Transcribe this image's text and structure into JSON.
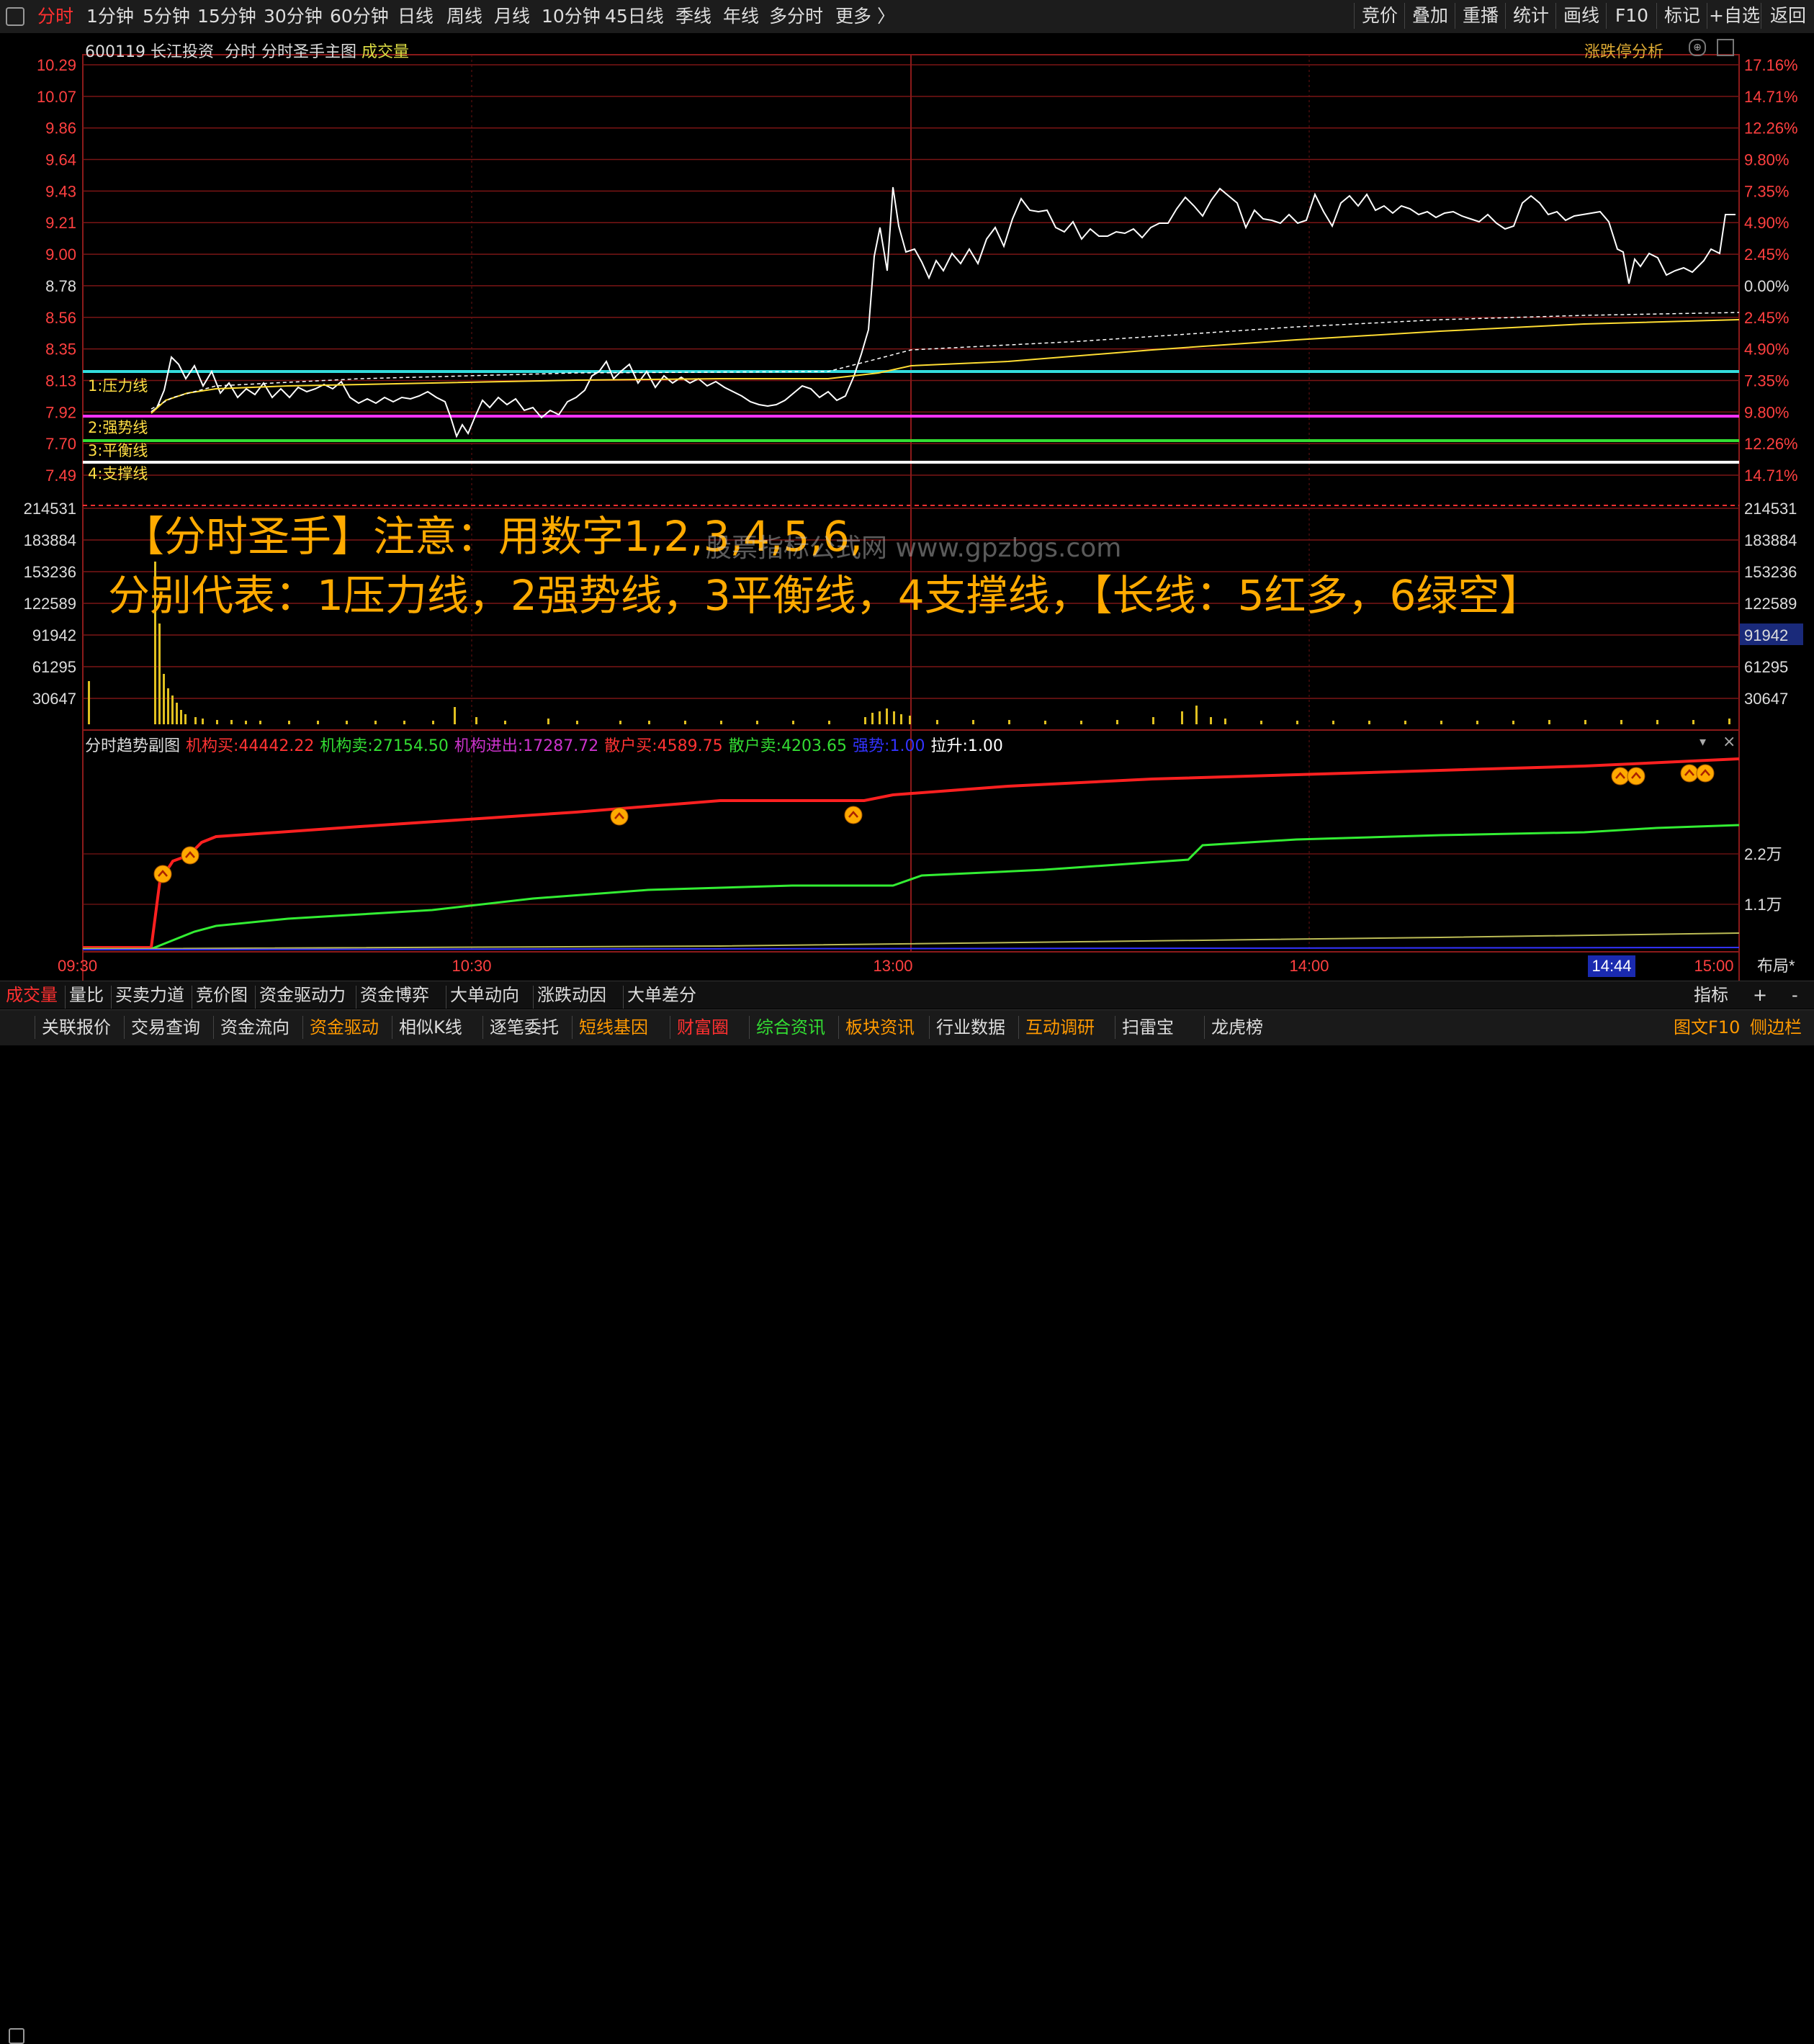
{
  "topbar": {
    "periods": [
      "分时",
      "1分钟",
      "5分钟",
      "15分钟",
      "30分钟",
      "60分钟",
      "日线",
      "周线",
      "月线",
      "10分钟",
      "45日线",
      "季线",
      "年线",
      "多分时",
      "更多 〉"
    ],
    "right_buttons": [
      "竞价",
      "叠加",
      "重播",
      "统计",
      "画线",
      "F10",
      "标记",
      "+自选",
      "返回"
    ]
  },
  "chart_header": {
    "code": "600119",
    "name": "长江投资",
    "mode": "分时",
    "indicator": "分时圣手主图",
    "volume_label": "成交量",
    "right_label": "涨跌停分析"
  },
  "price_axis": {
    "left": [
      "10.29",
      "10.07",
      "9.86",
      "9.64",
      "9.43",
      "9.21",
      "9.00",
      "8.78",
      "8.56",
      "8.35",
      "8.13",
      "7.92",
      "7.70",
      "7.49"
    ],
    "right": [
      "17.16%",
      "14.71%",
      "12.26%",
      "9.80%",
      "7.35%",
      "4.90%",
      "2.45%",
      "0.00%",
      "2.45%",
      "4.90%",
      "7.35%",
      "9.80%",
      "12.26%",
      "14.71%"
    ]
  },
  "lines": [
    {
      "label": "1:压力线",
      "color": "#33dddd"
    },
    {
      "label": "2:强势线",
      "color": "#ff33ff"
    },
    {
      "label": "3:平衡线",
      "color": "#33dd33"
    },
    {
      "label": "4:支撑线",
      "color": "#ffffff"
    }
  ],
  "volume_axis": {
    "left": [
      "214531",
      "183884",
      "153236",
      "122589",
      "91942",
      "61295",
      "30647"
    ],
    "right": [
      "214531",
      "183884",
      "153236",
      "122589",
      "91942",
      "61295",
      "30647"
    ],
    "highlight": "91942"
  },
  "annotation": {
    "line1": "【分时圣手】注意：用数字1,2,3,4,5,6,",
    "line2": "分别代表：1压力线，2强势线，3平衡线，4支撑线，【长线：5红多，6绿空】",
    "watermark": "股票指标公式网 www.gpzbgs.com"
  },
  "sub_chart": {
    "title": "分时趋势副图",
    "items": [
      {
        "label": "机构买:",
        "value": "44442.22",
        "color": "#ff3333"
      },
      {
        "label": "机构卖:",
        "value": "27154.50",
        "color": "#33dd33"
      },
      {
        "label": "机构进出:",
        "value": "17287.72",
        "color": "#cc33cc"
      },
      {
        "label": "散户买:",
        "value": "4589.75",
        "color": "#ff3333"
      },
      {
        "label": "散户卖:",
        "value": "4203.65",
        "color": "#33dd33"
      },
      {
        "label": "强势:",
        "value": "1.00",
        "color": "#3333ff"
      },
      {
        "label": "拉升:",
        "value": "1.00",
        "color": "#ffffff"
      }
    ],
    "axis": [
      "2.2万",
      "1.1万"
    ]
  },
  "time_axis": {
    "labels": [
      "09:30",
      "10:30",
      "13:00",
      "14:00",
      "15:00"
    ],
    "cursor": "14:44",
    "layout_label": "布局*"
  },
  "bottom_tabs": {
    "tabs": [
      "成交量",
      "量比",
      "买卖力道",
      "竞价图",
      "资金驱动力",
      "资金博弈",
      "大单动向",
      "涨跌动因",
      "大单差分"
    ],
    "right": [
      "指标",
      "+",
      "-"
    ]
  },
  "bottom_links": {
    "items": [
      "关联报价",
      "交易查询",
      "资金流向",
      "资金驱动",
      "相似K线",
      "逐笔委托",
      "短线基因",
      "财富圈",
      "综合资讯",
      "板块资讯",
      "行业数据",
      "互动调研",
      "扫雷宝",
      "龙虎榜"
    ],
    "right": [
      "图文F10",
      "侧边栏"
    ]
  },
  "chart_data": {
    "type": "line",
    "price_series_approx": [
      [
        "09:30",
        7.92
      ],
      [
        "09:40",
        7.95
      ],
      [
        "09:45",
        8.5
      ],
      [
        "09:55",
        8.35
      ],
      [
        "10:00",
        8.45
      ],
      [
        "10:10",
        8.28
      ],
      [
        "10:20",
        8.33
      ],
      [
        "10:30",
        8.2
      ],
      [
        "10:40",
        8.27
      ],
      [
        "10:50",
        8.1
      ],
      [
        "11:00",
        8.2
      ],
      [
        "11:10",
        8.15
      ],
      [
        "11:20",
        8.35
      ],
      [
        "11:30",
        8.3
      ],
      [
        "13:00",
        8.25
      ],
      [
        "13:10",
        8.15
      ],
      [
        "13:20",
        8.17
      ],
      [
        "13:30",
        8.22
      ],
      [
        "13:40",
        8.4
      ],
      [
        "13:45",
        9.06
      ],
      [
        "13:50",
        9.43
      ],
      [
        "13:55",
        9.1
      ],
      [
        "14:00",
        9.0
      ],
      [
        "14:05",
        9.28
      ],
      [
        "14:10",
        9.55
      ],
      [
        "14:15",
        9.35
      ],
      [
        "14:20",
        9.42
      ],
      [
        "14:30",
        9.6
      ],
      [
        "14:40",
        9.5
      ],
      [
        "14:50",
        9.62
      ],
      [
        "15:00",
        9.48
      ]
    ],
    "ylim": [
      7.49,
      10.29
    ]
  }
}
